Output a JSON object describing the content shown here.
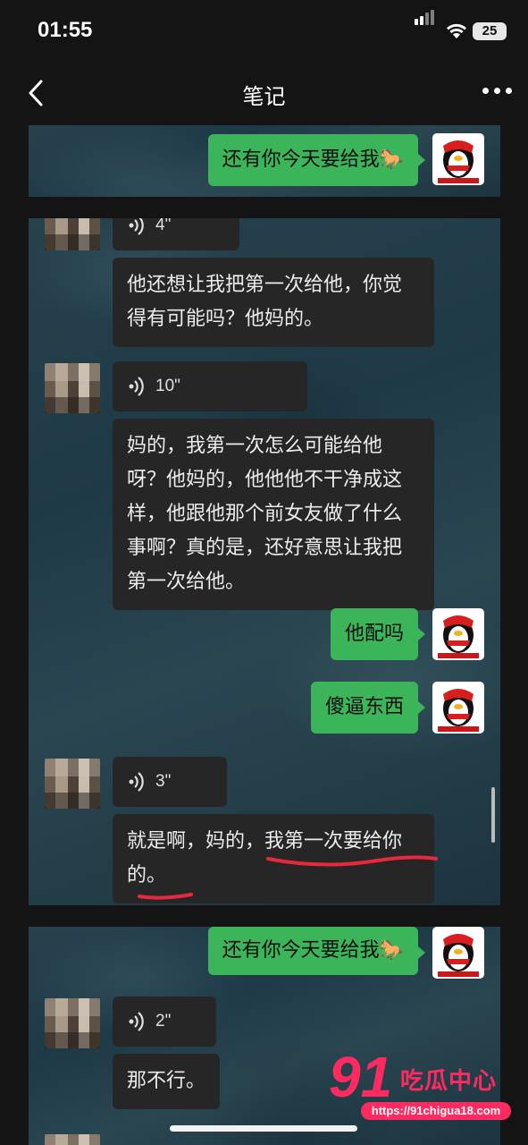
{
  "status": {
    "time": "01:55",
    "battery": "25"
  },
  "nav": {
    "title": "笔记"
  },
  "panels": [
    {
      "messages": [
        {
          "text": "还有你今天要给我"
        }
      ]
    },
    {
      "messages": [
        {
          "voice": "4\""
        },
        {
          "text": "他还想让我把第一次给他，你觉得有可能吗？他妈的。"
        },
        {
          "voice": "10\""
        },
        {
          "text": "妈的，我第一次怎么可能给他呀？他妈的，他他他不干净成这样，他跟他那个前女友做了什么事啊？真的是，还好意思让我把第一次给他。"
        },
        {
          "text": "他配吗"
        },
        {
          "text": "傻逼东西"
        },
        {
          "voice": "3\""
        },
        {
          "text": "就是啊，妈的，我第一次要给你的。"
        }
      ]
    },
    {
      "messages": [
        {
          "text": "还有你今天要给我"
        },
        {
          "voice": "2\""
        },
        {
          "text": "那不行。"
        }
      ]
    }
  ],
  "watermark": {
    "logo": "91",
    "name": "吃瓜中心",
    "url": "https://91chigua18.com"
  },
  "colors": {
    "bubble_mine": "#3cb45a",
    "bubble_other": "#262626",
    "annotation": "#e8283c"
  }
}
